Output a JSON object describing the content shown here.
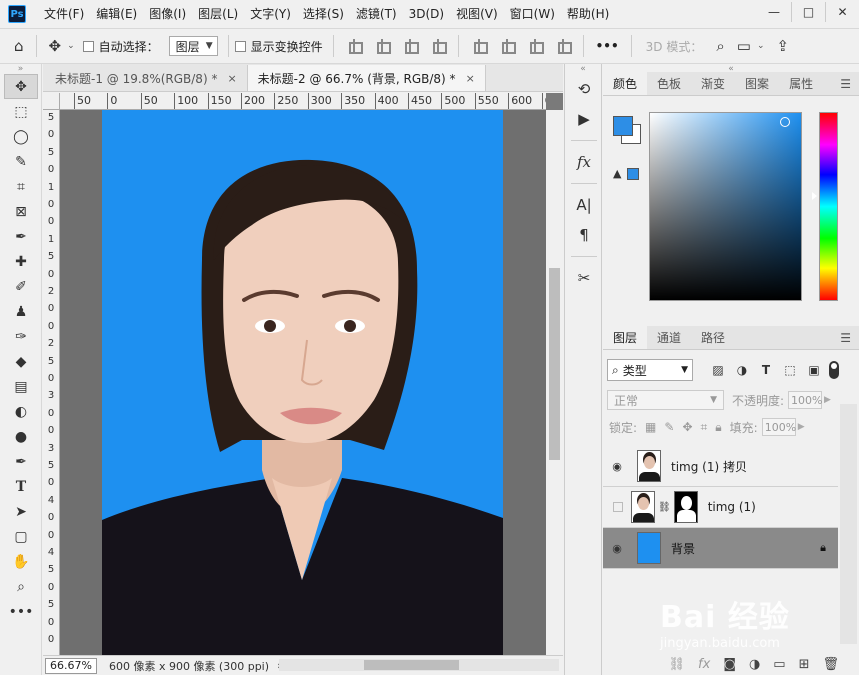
{
  "app": {
    "logo": "Ps"
  },
  "menu": [
    "文件(F)",
    "编辑(E)",
    "图像(I)",
    "图层(L)",
    "文字(Y)",
    "选择(S)",
    "滤镜(T)",
    "3D(D)",
    "视图(V)",
    "窗口(W)",
    "帮助(H)"
  ],
  "window_controls": {
    "minimize": "—",
    "maximize": "□",
    "close": "✕"
  },
  "options": {
    "auto_select_label": "自动选择：",
    "auto_select_target": "图层",
    "show_transform_label": "显示变换控件",
    "more": "•••",
    "mode_3d": "3D 模式："
  },
  "tabs": [
    {
      "label": "未标题-1 @ 19.8%(RGB/8) *",
      "close": "×"
    },
    {
      "label": "未标题-2 @ 66.7% (背景, RGB/8) *",
      "close": "×"
    }
  ],
  "ruler_h": [
    "50",
    "0",
    "50",
    "100",
    "150",
    "200",
    "250",
    "300",
    "350",
    "400",
    "450",
    "500",
    "550",
    "600",
    "6"
  ],
  "ruler_v": [
    "5",
    "0",
    "5",
    "0",
    "1",
    "0",
    "0",
    "1",
    "5",
    "0",
    "2",
    "0",
    "0",
    "2",
    "5",
    "0",
    "3",
    "0",
    "0",
    "3",
    "5",
    "0",
    "4",
    "0",
    "0",
    "4",
    "5",
    "0",
    "5",
    "0",
    "0"
  ],
  "status": {
    "zoom": "66.67%",
    "doc_info": "600 像素 x 900 像素 (300 ppi)",
    "arrow": "›"
  },
  "color_panel": {
    "tabs": [
      "颜色",
      "色板",
      "渐变",
      "图案",
      "属性"
    ],
    "foreground": "#2d8ee6",
    "background": "#ffffff"
  },
  "layers_panel": {
    "tabs": [
      "图层",
      "通道",
      "路径"
    ],
    "kind_filter": "类型",
    "blend_mode": "正常",
    "opacity_label": "不透明度:",
    "opacity": "100%",
    "lock_label": "锁定:",
    "fill_label": "填充:",
    "fill": "100%",
    "layers": [
      {
        "name": "timg (1) 拷贝",
        "visible": true
      },
      {
        "name": "timg (1)",
        "visible": false
      },
      {
        "name": "背景",
        "visible": true,
        "locked": true
      }
    ]
  },
  "watermark": {
    "brand": "Bai 经验",
    "url": "jingyan.baidu.com"
  },
  "colors": {
    "photo_bg": "#1e90f0",
    "ui_bg": "#f0f0f0",
    "selected_layer": "#8a8a8a"
  }
}
